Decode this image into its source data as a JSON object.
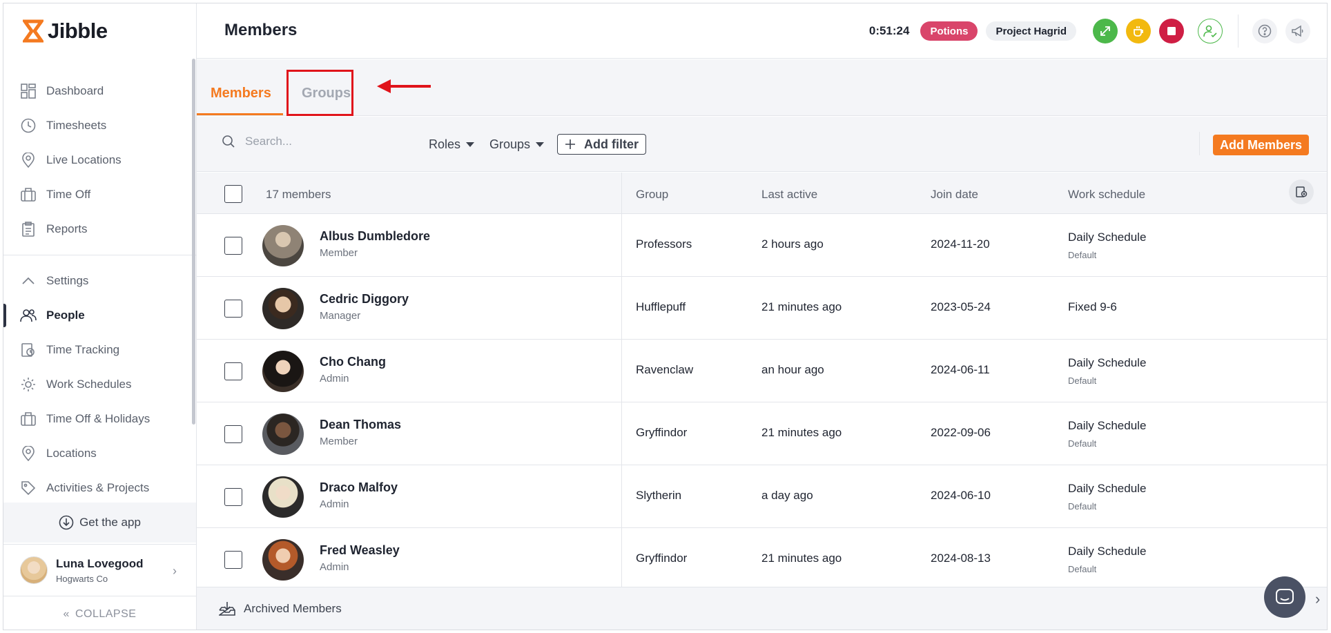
{
  "app": {
    "logo_text": "Jibble",
    "brand_color": "#f47a20"
  },
  "sidebar": {
    "items_top": [
      {
        "label": "Dashboard",
        "icon": "dashboard-icon"
      },
      {
        "label": "Timesheets",
        "icon": "clock-icon"
      },
      {
        "label": "Live Locations",
        "icon": "map-pin-icon"
      },
      {
        "label": "Time Off",
        "icon": "suitcase-icon"
      },
      {
        "label": "Reports",
        "icon": "report-icon"
      }
    ],
    "settings_label": "Settings",
    "items_settings": [
      {
        "label": "People",
        "icon": "people-icon",
        "active": true
      },
      {
        "label": "Time Tracking",
        "icon": "time-tracking-icon"
      },
      {
        "label": "Work Schedules",
        "icon": "work-schedule-icon"
      },
      {
        "label": "Time Off & Holidays",
        "icon": "suitcase-icon"
      },
      {
        "label": "Locations",
        "icon": "map-pin-icon"
      },
      {
        "label": "Activities & Projects",
        "icon": "tag-icon"
      }
    ],
    "get_app": "Get the app",
    "user": {
      "name": "Luna Lovegood",
      "org": "Hogwarts Co"
    },
    "collapse": "COLLAPSE"
  },
  "header": {
    "title": "Members",
    "timer": "0:51:24",
    "activity_pill": "Potions",
    "project_pill": "Project Hagrid"
  },
  "tabs": {
    "members": "Members",
    "groups": "Groups"
  },
  "toolbar": {
    "search_placeholder": "Search...",
    "roles": "Roles",
    "groups": "Groups",
    "add_filter": "Add filter",
    "add_members": "Add Members"
  },
  "table": {
    "count_label": "17 members",
    "headers": {
      "group": "Group",
      "last_active": "Last active",
      "join_date": "Join date",
      "work_schedule": "Work schedule"
    },
    "rows": [
      {
        "name": "Albus Dumbledore",
        "role": "Member",
        "group": "Professors",
        "last_active": "2 hours ago",
        "join_date": "2024-11-20",
        "schedule": "Daily Schedule",
        "schedule_sub": "Default"
      },
      {
        "name": "Cedric Diggory",
        "role": "Manager",
        "group": "Hufflepuff",
        "last_active": "21 minutes ago",
        "join_date": "2023-05-24",
        "schedule": "Fixed 9-6",
        "schedule_sub": ""
      },
      {
        "name": "Cho Chang",
        "role": "Admin",
        "group": "Ravenclaw",
        "last_active": "an hour ago",
        "join_date": "2024-06-11",
        "schedule": "Daily Schedule",
        "schedule_sub": "Default"
      },
      {
        "name": "Dean Thomas",
        "role": "Member",
        "group": "Gryffindor",
        "last_active": "21 minutes ago",
        "join_date": "2022-09-06",
        "schedule": "Daily Schedule",
        "schedule_sub": "Default"
      },
      {
        "name": "Draco Malfoy",
        "role": "Admin",
        "group": "Slytherin",
        "last_active": "a day ago",
        "join_date": "2024-06-10",
        "schedule": "Daily Schedule",
        "schedule_sub": "Default"
      },
      {
        "name": "Fred Weasley",
        "role": "Admin",
        "group": "Gryffindor",
        "last_active": "21 minutes ago",
        "join_date": "2024-08-13",
        "schedule": "Daily Schedule",
        "schedule_sub": "Default"
      }
    ]
  },
  "footer": {
    "archived": "Archived Members"
  }
}
